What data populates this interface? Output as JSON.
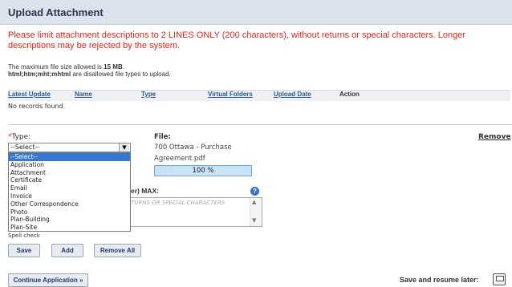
{
  "header": {
    "title": "Upload Attachment"
  },
  "warning": "Please limit attachment descriptions to 2 LINES ONLY (200 characters), without returns or special characters.  Longer descriptions may be rejected by the system.",
  "info": {
    "max_size_prefix": "The maximum file size allowed is ",
    "max_size_value": "15 MB",
    "max_size_suffix": ".",
    "disallowed_types": "html;htm;mht;mhtml",
    "disallowed_suffix": " are disallowed file types to upload."
  },
  "table": {
    "columns": [
      "Latest Update",
      "Name",
      "Type",
      "Virtual Folders",
      "Upload Date",
      "Action"
    ],
    "empty_message": "No records found."
  },
  "type_field": {
    "required_marker": "*",
    "label": "Type:",
    "selected": "--Select--",
    "options": [
      "--Select--",
      "Application",
      "Attachment",
      "Certificate",
      "Email",
      "Invoice",
      "Other Correspondence",
      "Photo",
      "Plan-Building",
      "Plan-Site"
    ]
  },
  "file_field": {
    "label": "File:",
    "file_name_line1": "700 Ottawa - Purchase",
    "file_name_line2": "Agreement.pdf",
    "progress_text": "100 %",
    "progress": 1.0
  },
  "remove_label": "Remove",
  "description": {
    "label_visible": "er) MAX:",
    "placeholder_visible": "TURNS OR SPECIAL CHARACTERS",
    "help_icon": "?"
  },
  "spell_check": "Spell check",
  "buttons": {
    "save": "Save",
    "add": "Add",
    "remove_all": "Remove All",
    "continue": "Continue Application »"
  },
  "save_resume": "Save and resume later:",
  "icons": {
    "save_resume": "save-icon",
    "help": "help-icon",
    "dropdown": "chevron-down-icon"
  },
  "colors": {
    "warning": "#e8251c",
    "header_bg": "#dde3ec",
    "selected_option": "#3478d4"
  }
}
